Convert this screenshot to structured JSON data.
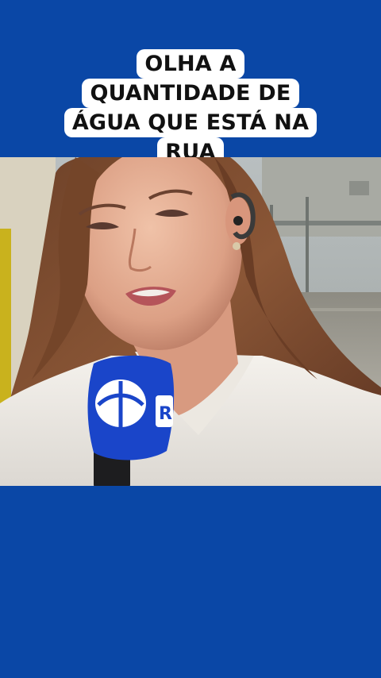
{
  "caption": {
    "lines": [
      "OLHA A",
      "QUANTIDADE DE",
      "ÁGUA QUE ESTÁ NA",
      "RUA"
    ]
  },
  "microphone": {
    "logo_letter": "R"
  },
  "colors": {
    "background": "#0a47a6",
    "caption_bg": "#ffffff",
    "caption_text": "#111111",
    "mic_flag": "#1a45c9"
  },
  "video": {
    "subject": "reporter-holding-microphone",
    "scene": "flooded-street"
  }
}
